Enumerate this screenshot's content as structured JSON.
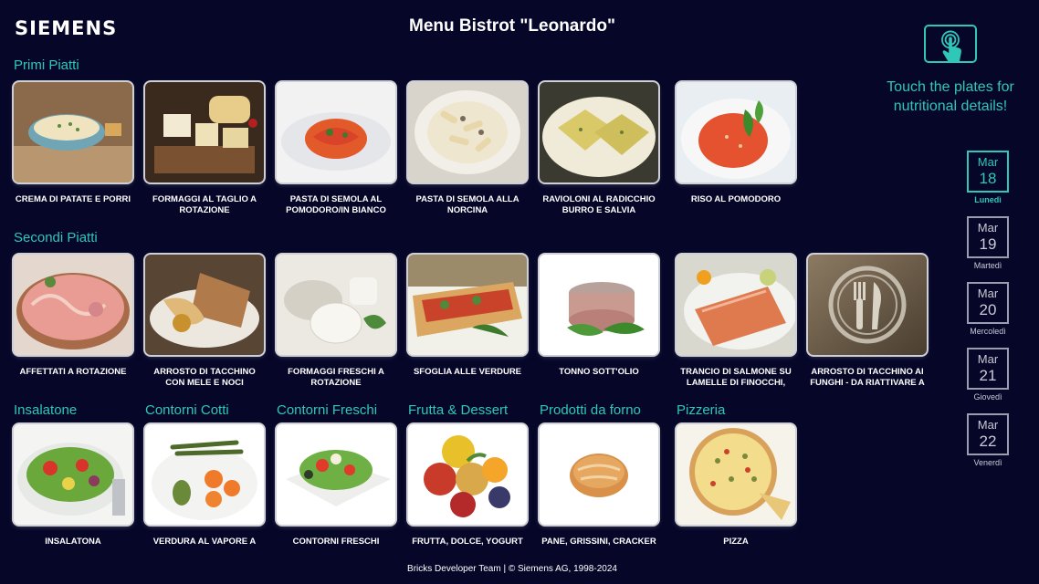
{
  "header": {
    "brand": "SIEMENS",
    "title": "Menu Bistrot \"Leonardo\""
  },
  "sections": {
    "primi": "Primi Piatti",
    "secondi": "Secondi Piatti",
    "insalatone": "Insalatone",
    "contorni_cotti": "Contorni Cotti",
    "contorni_freschi": "Contorni Freschi",
    "frutta": "Frutta & Dessert",
    "forno": "Prodotti da forno",
    "pizzeria": "Pizzeria"
  },
  "primi": [
    {
      "name": "CREMA DI PATATE E PORRI",
      "icon": "soup-bowl"
    },
    {
      "name": "FORMAGGI AL TAGLIO A ROTAZIONE",
      "icon": "cheese-board"
    },
    {
      "name": "PASTA DI SEMOLA AL POMODORO/IN BIANCO",
      "icon": "spaghetti"
    },
    {
      "name": "PASTA DI SEMOLA ALLA NORCINA",
      "icon": "penne"
    },
    {
      "name": "RAVIOLONI AL RADICCHIO BURRO E SALVIA",
      "icon": "ravioli"
    },
    {
      "name": "RISO AL POMODORO",
      "icon": "risotto"
    }
  ],
  "secondi": [
    {
      "name": "AFFETTATI A ROTAZIONE",
      "icon": "cold-cuts"
    },
    {
      "name": "ARROSTO DI TACCHINO CON MELE E NOCI",
      "icon": "roast"
    },
    {
      "name": "FORMAGGI FRESCHI A ROTAZIONE",
      "icon": "fresh-cheese"
    },
    {
      "name": "SFOGLIA ALLE VERDURE",
      "icon": "vegetable-tart"
    },
    {
      "name": "TONNO SOTT'OLIO",
      "icon": "tuna"
    },
    {
      "name": "TRANCIO DI SALMONE SU LAMELLE DI FINOCCHI, PEPE",
      "icon": "salmon"
    },
    {
      "name": "ARROSTO DI TACCHINO AI FUNGHI - Da riattivare a",
      "icon": "fork-knife-placeholder"
    }
  ],
  "bottom": [
    {
      "name": "INSALATONA",
      "icon": "salad"
    },
    {
      "name": "VERDURA AL VAPORE A",
      "icon": "steamed-vegetables"
    },
    {
      "name": "CONTORNI FRESCHI",
      "icon": "fresh-salad"
    },
    {
      "name": "FRUTTA, DOLCE, YOGURT",
      "icon": "fruit"
    },
    {
      "name": "PANE, GRISSINI, CRACKER",
      "icon": "bread-roll"
    },
    {
      "name": "PIZZA",
      "icon": "pizza"
    }
  ],
  "sidebar": {
    "touch_text": "Touch the plates for nutritional details!",
    "touch_icon": "touch-hand-icon",
    "days": [
      {
        "month": "Mar",
        "day": "18",
        "name": "Lunedì",
        "active": true
      },
      {
        "month": "Mar",
        "day": "19",
        "name": "Martedì",
        "active": false
      },
      {
        "month": "Mar",
        "day": "20",
        "name": "Mercoledì",
        "active": false
      },
      {
        "month": "Mar",
        "day": "21",
        "name": "Giovedì",
        "active": false
      },
      {
        "month": "Mar",
        "day": "22",
        "name": "Venerdì",
        "active": false
      }
    ]
  },
  "footer": "Bricks Developer Team | © Siemens AG, 1998-2024",
  "colors": {
    "background": "#050628",
    "accent": "#2fc7b8"
  }
}
